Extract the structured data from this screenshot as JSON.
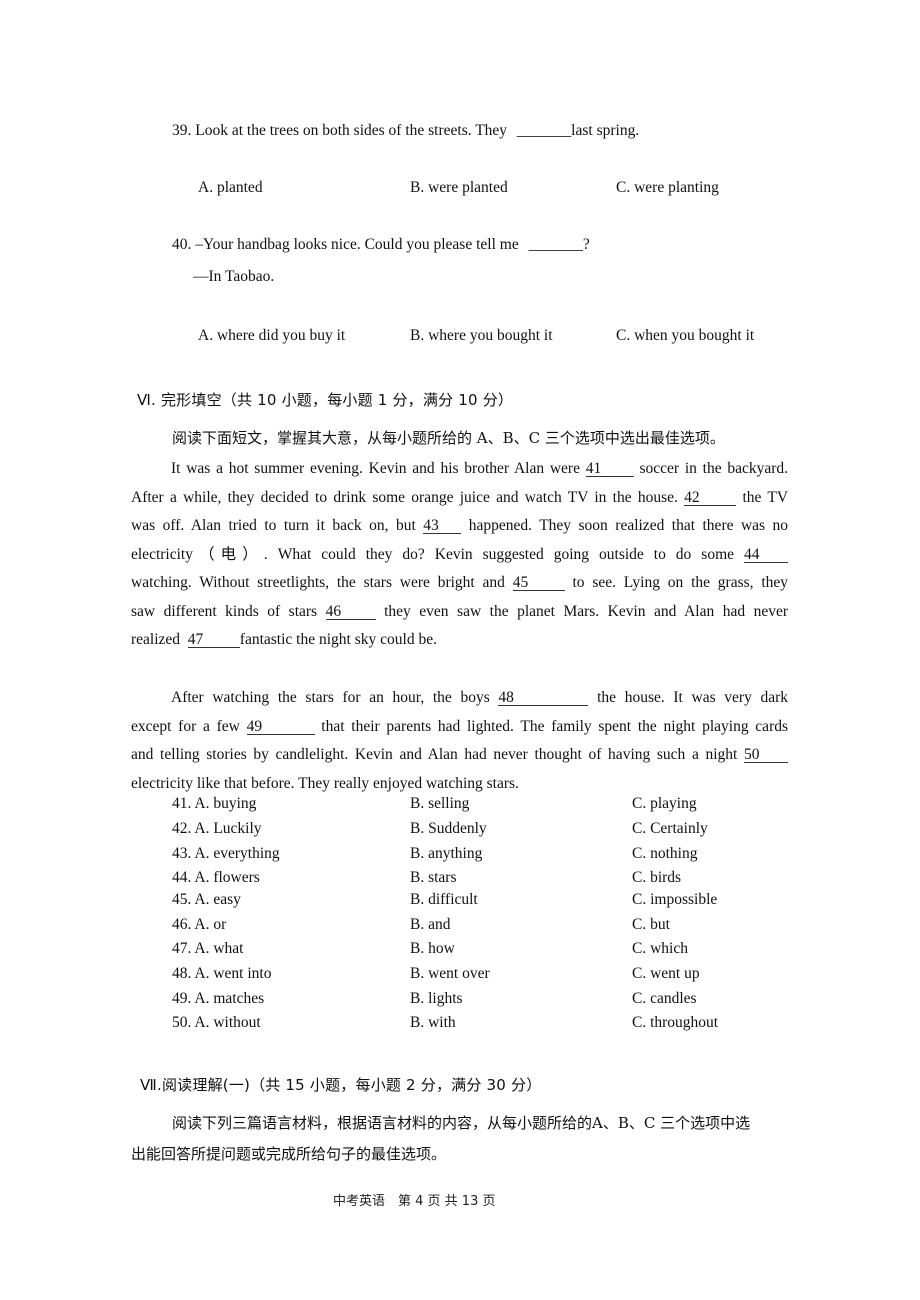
{
  "q39": {
    "stem_before": "39. Look at the trees on both sides of the streets. They",
    "blank": "_______",
    "stem_after": "last spring.",
    "options": [
      "A. planted",
      "B. were planted",
      "C. were planting"
    ]
  },
  "q40": {
    "stem_before": "40. –Your handbag looks nice. Could you please tell me",
    "blank": "_______",
    "stem_after": "?",
    "reply": "—In Taobao.",
    "options": [
      "A. where did you buy it",
      "B. where you bought it",
      "C. when you bought it"
    ]
  },
  "section6": {
    "title": "Ⅵ. 完形填空（共 10 小题，每小题 1 分，满分 10 分）",
    "instruction": "阅读下面短文，掌握其大意，从每小题所给的 A、B、C 三个选项中选出最佳选项。",
    "para1": {
      "l1a": "It was a hot summer evening. Kevin and his brother Alan were",
      "b41": "41",
      "l1b": "soccer in the backyard.",
      "l2a": "After a while, they decided to drink some orange juice and watch TV in the house.",
      "b42": "42",
      "l2b": "the TV",
      "l3a": "was off. Alan tried to turn it back on, but",
      "b43": "43",
      "l3b": "happened. They soon realized that there was no",
      "l4a": "electricity（电）. What could they do? Kevin suggested going outside to do some",
      "b44": "44",
      "l5a": "watching. Without streetlights, the stars were bright and",
      "b45": "45",
      "l5b": "to see. Lying on the grass, they",
      "l6a": "saw different kinds of stars",
      "b46": "46",
      "l6b": "they even saw the planet Mars. Kevin and Alan had never",
      "l7a": "realized",
      "b47": "47",
      "l7b": "fantastic the night sky could be."
    },
    "para2": {
      "l1a": "After watching the stars for an hour, the boys",
      "b48": "48",
      "l1b": "the house. It was very dark",
      "l2a": "except for a few",
      "b49": "49",
      "l2b": "that their parents had lighted. The family spent the night playing cards",
      "l3a": "and telling stories by candlelight. Kevin and Alan had never thought of having such a night",
      "b50": "50",
      "l4a": "electricity like that before. They really enjoyed watching stars."
    },
    "choices": [
      {
        "a": "41. A. buying",
        "b": "B. selling",
        "c": "C. playing"
      },
      {
        "a": "42. A. Luckily",
        "b": "B. Suddenly",
        "c": "C. Certainly"
      },
      {
        "a": "43. A. everything",
        "b": "B. anything",
        "c": "C. nothing"
      },
      {
        "a": "44. A. flowers",
        "b": "B. stars",
        "c": "C. birds"
      },
      {
        "a": "45. A. easy",
        "b": "B. difficult",
        "c": "C. impossible"
      },
      {
        "a": "46. A. or",
        "b": "B. and",
        "c": "C. but"
      },
      {
        "a": "47. A. what",
        "b": "B. how",
        "c": "C. which"
      },
      {
        "a": "48. A. went into",
        "b": "B. went over",
        "c": "C. went up"
      },
      {
        "a": "49. A. matches",
        "b": "B. lights",
        "c": "C. candles"
      },
      {
        "a": "50. A. without",
        "b": "B. with",
        "c": "C. throughout"
      }
    ]
  },
  "section7": {
    "title": "Ⅶ.阅读理解(一)（共 15 小题，每小题 2 分，满分 30 分）",
    "instruction_l1": "阅读下列三篇语言材料，根据语言材料的内容，从每小题所给的A、B、C 三个选项中选",
    "instruction_l2": "出能回答所提问题或完成所给句子的最佳选项。"
  },
  "footer": {
    "text": "中考英语　第 4 页 共 13 页"
  }
}
